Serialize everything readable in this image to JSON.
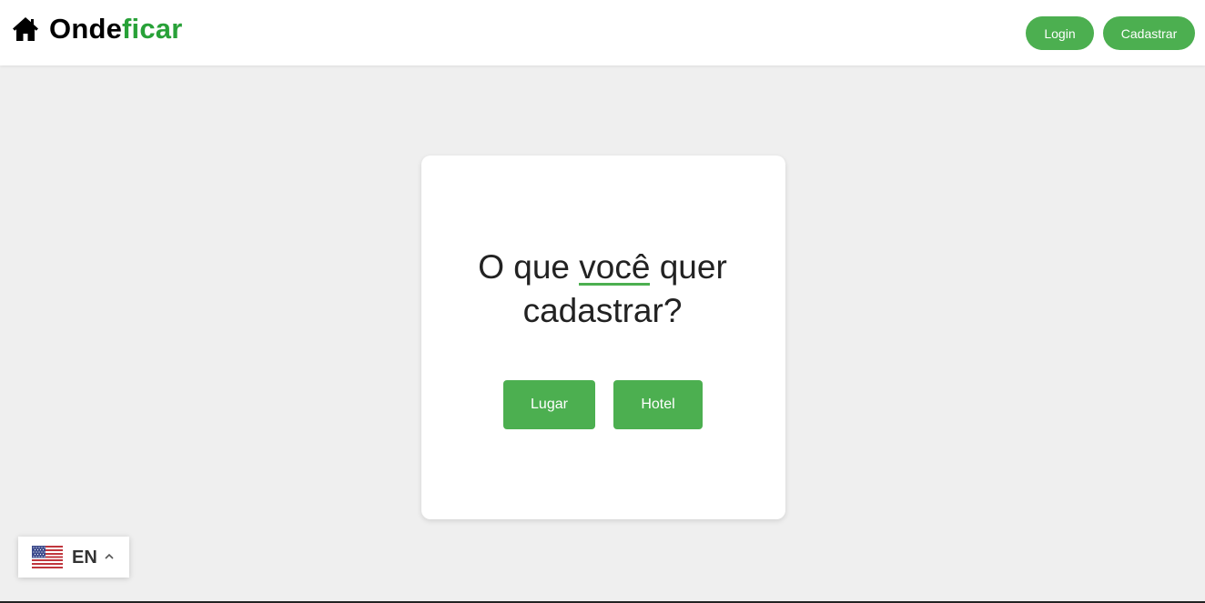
{
  "header": {
    "brand_part1": "Onde",
    "brand_part2": "ficar",
    "login_label": "Login",
    "signup_label": "Cadastrar"
  },
  "card": {
    "question_pre": "O que ",
    "question_highlight": "você",
    "question_post": " quer cadastrar?",
    "place_label": "Lugar",
    "hotel_label": "Hotel"
  },
  "language": {
    "code": "EN",
    "flag": "us-flag-icon"
  },
  "colors": {
    "accent": "#4caf50",
    "brand_green": "#28a138",
    "background": "#efefef"
  }
}
